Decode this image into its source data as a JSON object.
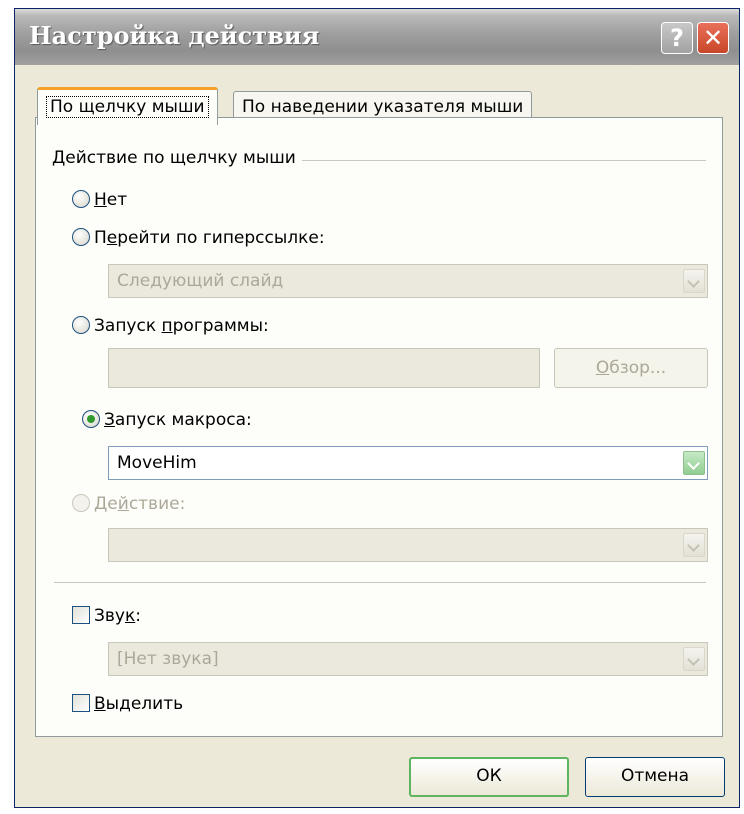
{
  "window": {
    "title": "Настройка действия",
    "help_label": "?",
    "close_label": "✕"
  },
  "tabs": [
    {
      "label": "По щелчку мыши",
      "active": true
    },
    {
      "label": "По наведении указателя мыши",
      "active": false
    }
  ],
  "group_label": "Действие по щелчку мыши",
  "options": {
    "none": {
      "label_u": "Н",
      "label_rest": "ет",
      "checked": false
    },
    "hyperlink": {
      "label_pre": "П",
      "label_u": "е",
      "label_rest": "рейти по гиперссылке:",
      "checked": false,
      "value": "Следующий слайд"
    },
    "program": {
      "label_pre": "Запуск ",
      "label_u": "п",
      "label_rest": "рограммы:",
      "checked": false,
      "value": "",
      "browse_pre": "",
      "browse_u": "О",
      "browse_rest": "бзор..."
    },
    "macro": {
      "label_u": "З",
      "label_rest": "апуск макроса:",
      "checked": true,
      "value": "MoveHim"
    },
    "action": {
      "label_pre": "Де",
      "label_u": "й",
      "label_rest": "ствие:",
      "checked": false,
      "enabled": false,
      "value": ""
    }
  },
  "sound": {
    "label_pre": "Зву",
    "label_u": "к",
    "label_rest": ":",
    "checked": false,
    "value": "[Нет звука]"
  },
  "highlight": {
    "label_u": "В",
    "label_rest": "ыделить",
    "checked": false
  },
  "buttons": {
    "ok": "ОК",
    "cancel": "Отмена"
  }
}
